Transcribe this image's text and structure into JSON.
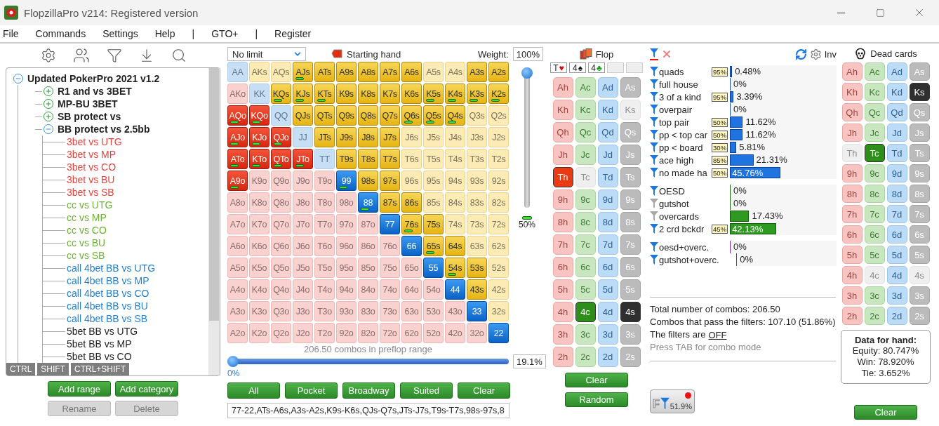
{
  "window": {
    "title": "FlopzillaPro v214: Registered version"
  },
  "menu": [
    {
      "label": "File",
      "kind": "item"
    },
    {
      "label": "Commands",
      "kind": "item"
    },
    {
      "label": "Settings",
      "kind": "item"
    },
    {
      "label": "Help",
      "kind": "item"
    },
    {
      "label": "|",
      "kind": "separator"
    },
    {
      "label": "GTO+",
      "kind": "item"
    },
    {
      "label": "|",
      "kind": "separator"
    },
    {
      "label": "Register",
      "kind": "item"
    }
  ],
  "ranges": {
    "tree": {
      "label": "Updated PokerPro 2021 v1.2",
      "expanded": true,
      "children": [
        {
          "label": "R1 and vs 3BET",
          "expanded": false
        },
        {
          "label": "MP-BU 3BET",
          "expanded": false
        },
        {
          "label": "SB protect vs",
          "expanded": false
        },
        {
          "label": "BB protect vs 2.5bb",
          "expanded": true,
          "children": [
            {
              "label": "3bet vs UTG",
              "color": "#e8413c"
            },
            {
              "label": "3bet vs MP",
              "color": "#e8413c"
            },
            {
              "label": "3bet vs CO",
              "color": "#e8413c"
            },
            {
              "label": "3bet vs BU",
              "color": "#e8413c"
            },
            {
              "label": "3bet vs SB",
              "color": "#e8413c"
            },
            {
              "label": "cc vs UTG",
              "color": "#6cb232"
            },
            {
              "label": "cc vs MP",
              "color": "#6cb232"
            },
            {
              "label": "cc vs CO",
              "color": "#6cb232"
            },
            {
              "label": "cc vs BU",
              "color": "#6cb232"
            },
            {
              "label": "cc vs SB",
              "color": "#6cb232"
            },
            {
              "label": "call 4bet BB vs UTG",
              "color": "#1f7fd0"
            },
            {
              "label": "call 4bet BB vs MP",
              "color": "#1f7fd0"
            },
            {
              "label": "call 4bet BB vs CO",
              "color": "#1f7fd0"
            },
            {
              "label": "call 4bet BB vs BU",
              "color": "#1f7fd0"
            },
            {
              "label": "call 4bet BB vs SB",
              "color": "#1f7fd0"
            },
            {
              "label": "5bet BB vs UTG",
              "color": "#222222"
            },
            {
              "label": "5bet BB vs MP",
              "color": "#222222"
            },
            {
              "label": "5bet BB vs CO",
              "color": "#222222"
            }
          ]
        }
      ]
    },
    "modifier_keys": [
      "CTRL",
      "SHIFT",
      "CTRL+SHIFT"
    ],
    "buttons": [
      {
        "label": "Add range",
        "disabled": false
      },
      {
        "label": "Add category",
        "disabled": false
      },
      {
        "label": "Rename",
        "disabled": true
      },
      {
        "label": "Delete",
        "disabled": true
      }
    ]
  },
  "hand_matrix": {
    "game": "No limit",
    "title": "Starting hand",
    "weight_label": "Weight:",
    "weight": "100%",
    "threshold": {
      "level": 1,
      "reading": "50%"
    },
    "rows": [
      [
        {
          "label": "AA",
          "selected": false,
          "weight_mark": false
        },
        {
          "label": "AKs",
          "selected": false,
          "weight_mark": false
        },
        {
          "label": "AQs",
          "selected": false,
          "weight_mark": false
        },
        {
          "label": "AJs",
          "selected": true,
          "weight_mark": true
        },
        {
          "label": "ATs",
          "selected": true,
          "weight_mark": false
        },
        {
          "label": "A9s",
          "selected": true,
          "weight_mark": false
        },
        {
          "label": "A8s",
          "selected": true,
          "weight_mark": false
        },
        {
          "label": "A7s",
          "selected": true,
          "weight_mark": false
        },
        {
          "label": "A6s",
          "selected": true,
          "weight_mark": false
        },
        {
          "label": "A5s",
          "selected": false,
          "weight_mark": false
        },
        {
          "label": "A4s",
          "selected": false,
          "weight_mark": false
        },
        {
          "label": "A3s",
          "selected": true,
          "weight_mark": false
        },
        {
          "label": "A2s",
          "selected": true,
          "weight_mark": false
        }
      ],
      [
        {
          "label": "AKo",
          "selected": false,
          "weight_mark": false
        },
        {
          "label": "KK",
          "selected": false,
          "weight_mark": false
        },
        {
          "label": "KQs",
          "selected": true,
          "weight_mark": true
        },
        {
          "label": "KJs",
          "selected": true,
          "weight_mark": true
        },
        {
          "label": "KTs",
          "selected": true,
          "weight_mark": true
        },
        {
          "label": "K9s",
          "selected": true,
          "weight_mark": false
        },
        {
          "label": "K8s",
          "selected": true,
          "weight_mark": false
        },
        {
          "label": "K7s",
          "selected": true,
          "weight_mark": false
        },
        {
          "label": "K6s",
          "selected": true,
          "weight_mark": false
        },
        {
          "label": "K5s",
          "selected": true,
          "weight_mark": true
        },
        {
          "label": "K4s",
          "selected": true,
          "weight_mark": true
        },
        {
          "label": "K3s",
          "selected": true,
          "weight_mark": true
        },
        {
          "label": "K2s",
          "selected": true,
          "weight_mark": true
        }
      ],
      [
        {
          "label": "AQo",
          "selected": true,
          "weight_mark": true
        },
        {
          "label": "KQo",
          "selected": true,
          "weight_mark": true
        },
        {
          "label": "QQ",
          "selected": false,
          "weight_mark": false
        },
        {
          "label": "QJs",
          "selected": true,
          "weight_mark": false
        },
        {
          "label": "QTs",
          "selected": true,
          "weight_mark": false
        },
        {
          "label": "Q9s",
          "selected": true,
          "weight_mark": false
        },
        {
          "label": "Q8s",
          "selected": true,
          "weight_mark": false
        },
        {
          "label": "Q7s",
          "selected": true,
          "weight_mark": false
        },
        {
          "label": "Q6s",
          "selected": true,
          "weight_mark": true
        },
        {
          "label": "Q5s",
          "selected": true,
          "weight_mark": true
        },
        {
          "label": "Q4s",
          "selected": true,
          "weight_mark": true
        },
        {
          "label": "Q3s",
          "selected": false,
          "weight_mark": false
        },
        {
          "label": "Q2s",
          "selected": false,
          "weight_mark": false
        }
      ],
      [
        {
          "label": "AJo",
          "selected": true,
          "weight_mark": true
        },
        {
          "label": "KJo",
          "selected": true,
          "weight_mark": true
        },
        {
          "label": "QJo",
          "selected": true,
          "weight_mark": true
        },
        {
          "label": "JJ",
          "selected": false,
          "weight_mark": false
        },
        {
          "label": "JTs",
          "selected": true,
          "weight_mark": false
        },
        {
          "label": "J9s",
          "selected": true,
          "weight_mark": false
        },
        {
          "label": "J8s",
          "selected": true,
          "weight_mark": false
        },
        {
          "label": "J7s",
          "selected": true,
          "weight_mark": false
        },
        {
          "label": "J6s",
          "selected": false,
          "weight_mark": false
        },
        {
          "label": "J5s",
          "selected": false,
          "weight_mark": false
        },
        {
          "label": "J4s",
          "selected": false,
          "weight_mark": false
        },
        {
          "label": "J3s",
          "selected": false,
          "weight_mark": false
        },
        {
          "label": "J2s",
          "selected": false,
          "weight_mark": false
        }
      ],
      [
        {
          "label": "ATo",
          "selected": true,
          "weight_mark": true
        },
        {
          "label": "KTo",
          "selected": true,
          "weight_mark": true
        },
        {
          "label": "QTo",
          "selected": true,
          "weight_mark": true
        },
        {
          "label": "JTo",
          "selected": true,
          "weight_mark": true
        },
        {
          "label": "TT",
          "selected": false,
          "weight_mark": false
        },
        {
          "label": "T9s",
          "selected": true,
          "weight_mark": false
        },
        {
          "label": "T8s",
          "selected": true,
          "weight_mark": false
        },
        {
          "label": "T7s",
          "selected": true,
          "weight_mark": false
        },
        {
          "label": "T6s",
          "selected": false,
          "weight_mark": false
        },
        {
          "label": "T5s",
          "selected": false,
          "weight_mark": false
        },
        {
          "label": "T4s",
          "selected": false,
          "weight_mark": false
        },
        {
          "label": "T3s",
          "selected": false,
          "weight_mark": false
        },
        {
          "label": "T2s",
          "selected": false,
          "weight_mark": false
        }
      ],
      [
        {
          "label": "A9o",
          "selected": true,
          "weight_mark": true
        },
        {
          "label": "K9o",
          "selected": false,
          "weight_mark": false
        },
        {
          "label": "Q9o",
          "selected": false,
          "weight_mark": false
        },
        {
          "label": "J9o",
          "selected": false,
          "weight_mark": false
        },
        {
          "label": "T9o",
          "selected": false,
          "weight_mark": false
        },
        {
          "label": "99",
          "selected": true,
          "weight_mark": true
        },
        {
          "label": "98s",
          "selected": true,
          "weight_mark": false
        },
        {
          "label": "97s",
          "selected": true,
          "weight_mark": false
        },
        {
          "label": "96s",
          "selected": false,
          "weight_mark": false
        },
        {
          "label": "95s",
          "selected": false,
          "weight_mark": false
        },
        {
          "label": "94s",
          "selected": false,
          "weight_mark": false
        },
        {
          "label": "93s",
          "selected": false,
          "weight_mark": false
        },
        {
          "label": "92s",
          "selected": false,
          "weight_mark": false
        }
      ],
      [
        {
          "label": "A8o",
          "selected": false,
          "weight_mark": false
        },
        {
          "label": "K8o",
          "selected": false,
          "weight_mark": false
        },
        {
          "label": "Q8o",
          "selected": false,
          "weight_mark": false
        },
        {
          "label": "J8o",
          "selected": false,
          "weight_mark": false
        },
        {
          "label": "T8o",
          "selected": false,
          "weight_mark": false
        },
        {
          "label": "98o",
          "selected": false,
          "weight_mark": false
        },
        {
          "label": "88",
          "selected": true,
          "weight_mark": true
        },
        {
          "label": "87s",
          "selected": true,
          "weight_mark": false
        },
        {
          "label": "86s",
          "selected": true,
          "weight_mark": false
        },
        {
          "label": "85s",
          "selected": false,
          "weight_mark": false
        },
        {
          "label": "84s",
          "selected": false,
          "weight_mark": false
        },
        {
          "label": "83s",
          "selected": false,
          "weight_mark": false
        },
        {
          "label": "82s",
          "selected": false,
          "weight_mark": false
        }
      ],
      [
        {
          "label": "A7o",
          "selected": false,
          "weight_mark": false
        },
        {
          "label": "K7o",
          "selected": false,
          "weight_mark": false
        },
        {
          "label": "Q7o",
          "selected": false,
          "weight_mark": false
        },
        {
          "label": "J7o",
          "selected": false,
          "weight_mark": false
        },
        {
          "label": "T7o",
          "selected": false,
          "weight_mark": false
        },
        {
          "label": "97o",
          "selected": false,
          "weight_mark": false
        },
        {
          "label": "87o",
          "selected": false,
          "weight_mark": false
        },
        {
          "label": "77",
          "selected": true,
          "weight_mark": false
        },
        {
          "label": "76s",
          "selected": true,
          "weight_mark": true
        },
        {
          "label": "75s",
          "selected": true,
          "weight_mark": false
        },
        {
          "label": "74s",
          "selected": false,
          "weight_mark": false
        },
        {
          "label": "73s",
          "selected": false,
          "weight_mark": false
        },
        {
          "label": "72s",
          "selected": false,
          "weight_mark": false
        }
      ],
      [
        {
          "label": "A6o",
          "selected": false,
          "weight_mark": false
        },
        {
          "label": "K6o",
          "selected": false,
          "weight_mark": false
        },
        {
          "label": "Q6o",
          "selected": false,
          "weight_mark": false
        },
        {
          "label": "J6o",
          "selected": false,
          "weight_mark": false
        },
        {
          "label": "T6o",
          "selected": false,
          "weight_mark": false
        },
        {
          "label": "96o",
          "selected": false,
          "weight_mark": false
        },
        {
          "label": "86o",
          "selected": false,
          "weight_mark": false
        },
        {
          "label": "76o",
          "selected": false,
          "weight_mark": false
        },
        {
          "label": "66",
          "selected": true,
          "weight_mark": false
        },
        {
          "label": "65s",
          "selected": true,
          "weight_mark": true
        },
        {
          "label": "64s",
          "selected": true,
          "weight_mark": false
        },
        {
          "label": "63s",
          "selected": false,
          "weight_mark": false
        },
        {
          "label": "62s",
          "selected": false,
          "weight_mark": false
        }
      ],
      [
        {
          "label": "A5o",
          "selected": false,
          "weight_mark": false
        },
        {
          "label": "K5o",
          "selected": false,
          "weight_mark": false
        },
        {
          "label": "Q5o",
          "selected": false,
          "weight_mark": false
        },
        {
          "label": "J5o",
          "selected": false,
          "weight_mark": false
        },
        {
          "label": "T5o",
          "selected": false,
          "weight_mark": false
        },
        {
          "label": "95o",
          "selected": false,
          "weight_mark": false
        },
        {
          "label": "85o",
          "selected": false,
          "weight_mark": false
        },
        {
          "label": "75o",
          "selected": false,
          "weight_mark": false
        },
        {
          "label": "65o",
          "selected": false,
          "weight_mark": false
        },
        {
          "label": "55",
          "selected": true,
          "weight_mark": false
        },
        {
          "label": "54s",
          "selected": true,
          "weight_mark": true
        },
        {
          "label": "53s",
          "selected": true,
          "weight_mark": false
        },
        {
          "label": "52s",
          "selected": false,
          "weight_mark": false
        }
      ],
      [
        {
          "label": "A4o",
          "selected": false,
          "weight_mark": false
        },
        {
          "label": "K4o",
          "selected": false,
          "weight_mark": false
        },
        {
          "label": "Q4o",
          "selected": false,
          "weight_mark": false
        },
        {
          "label": "J4o",
          "selected": false,
          "weight_mark": false
        },
        {
          "label": "T4o",
          "selected": false,
          "weight_mark": false
        },
        {
          "label": "94o",
          "selected": false,
          "weight_mark": false
        },
        {
          "label": "84o",
          "selected": false,
          "weight_mark": false
        },
        {
          "label": "74o",
          "selected": false,
          "weight_mark": false
        },
        {
          "label": "64o",
          "selected": false,
          "weight_mark": false
        },
        {
          "label": "54o",
          "selected": false,
          "weight_mark": false
        },
        {
          "label": "44",
          "selected": true,
          "weight_mark": false
        },
        {
          "label": "43s",
          "selected": true,
          "weight_mark": false
        },
        {
          "label": "42s",
          "selected": false,
          "weight_mark": false
        }
      ],
      [
        {
          "label": "A3o",
          "selected": false,
          "weight_mark": false
        },
        {
          "label": "K3o",
          "selected": false,
          "weight_mark": false
        },
        {
          "label": "Q3o",
          "selected": false,
          "weight_mark": false
        },
        {
          "label": "J3o",
          "selected": false,
          "weight_mark": false
        },
        {
          "label": "T3o",
          "selected": false,
          "weight_mark": false
        },
        {
          "label": "93o",
          "selected": false,
          "weight_mark": false
        },
        {
          "label": "83o",
          "selected": false,
          "weight_mark": false
        },
        {
          "label": "73o",
          "selected": false,
          "weight_mark": false
        },
        {
          "label": "63o",
          "selected": false,
          "weight_mark": false
        },
        {
          "label": "53o",
          "selected": false,
          "weight_mark": false
        },
        {
          "label": "43o",
          "selected": false,
          "weight_mark": false
        },
        {
          "label": "33",
          "selected": true,
          "weight_mark": false
        },
        {
          "label": "32s",
          "selected": false,
          "weight_mark": false
        }
      ],
      [
        {
          "label": "A2o",
          "selected": false,
          "weight_mark": false
        },
        {
          "label": "K2o",
          "selected": false,
          "weight_mark": false
        },
        {
          "label": "Q2o",
          "selected": false,
          "weight_mark": false
        },
        {
          "label": "J2o",
          "selected": false,
          "weight_mark": false
        },
        {
          "label": "T2o",
          "selected": false,
          "weight_mark": false
        },
        {
          "label": "92o",
          "selected": false,
          "weight_mark": false
        },
        {
          "label": "82o",
          "selected": false,
          "weight_mark": false
        },
        {
          "label": "72o",
          "selected": false,
          "weight_mark": false
        },
        {
          "label": "62o",
          "selected": false,
          "weight_mark": false
        },
        {
          "label": "52o",
          "selected": false,
          "weight_mark": false
        },
        {
          "label": "42o",
          "selected": false,
          "weight_mark": false
        },
        {
          "label": "32o",
          "selected": false,
          "weight_mark": false
        },
        {
          "label": "22",
          "selected": true,
          "weight_mark": false
        }
      ]
    ],
    "combos_caption": "206.50 combos in preflop range",
    "range_slider": {
      "level": 0,
      "reading": "0%"
    },
    "range_percent": "19.1%",
    "buttons": [
      "All",
      "Pocket",
      "Broadway",
      "Suited",
      "Clear"
    ],
    "range_text": "77-22,ATs-A6s,A3s-A2s,K9s-K6s,QJs-Q7s,JTs-J7s,T9s-T7s,98s-97s,8"
  },
  "flop": {
    "title": "Flop",
    "board": [
      {
        "rank": "T",
        "suit": "♥",
        "color": "#e00000"
      },
      {
        "rank": "4",
        "suit": "♠",
        "color": "#111111"
      },
      {
        "rank": "4",
        "suit": "♣",
        "color": "#1a9a1a"
      }
    ],
    "cards": [
      {
        "label": "Ah",
        "selected": false,
        "disabled": false
      },
      {
        "label": "Ac",
        "selected": false,
        "disabled": false
      },
      {
        "label": "Ad",
        "selected": false,
        "disabled": false
      },
      {
        "label": "As",
        "selected": false,
        "disabled": false
      },
      {
        "label": "Kh",
        "selected": false,
        "disabled": false
      },
      {
        "label": "Kc",
        "selected": false,
        "disabled": false
      },
      {
        "label": "Kd",
        "selected": false,
        "disabled": false
      },
      {
        "label": "Ks",
        "selected": false,
        "disabled": true
      },
      {
        "label": "Qh",
        "selected": false,
        "disabled": false
      },
      {
        "label": "Qc",
        "selected": false,
        "disabled": false
      },
      {
        "label": "Qd",
        "selected": false,
        "disabled": false
      },
      {
        "label": "Qs",
        "selected": false,
        "disabled": false
      },
      {
        "label": "Jh",
        "selected": false,
        "disabled": false
      },
      {
        "label": "Jc",
        "selected": false,
        "disabled": false
      },
      {
        "label": "Jd",
        "selected": false,
        "disabled": false
      },
      {
        "label": "Js",
        "selected": false,
        "disabled": false
      },
      {
        "label": "Th",
        "selected": true,
        "disabled": false
      },
      {
        "label": "Tc",
        "selected": false,
        "disabled": true
      },
      {
        "label": "Td",
        "selected": false,
        "disabled": false
      },
      {
        "label": "Ts",
        "selected": false,
        "disabled": false
      },
      {
        "label": "9h",
        "selected": false,
        "disabled": false
      },
      {
        "label": "9c",
        "selected": false,
        "disabled": false
      },
      {
        "label": "9d",
        "selected": false,
        "disabled": false
      },
      {
        "label": "9s",
        "selected": false,
        "disabled": false
      },
      {
        "label": "8h",
        "selected": false,
        "disabled": false
      },
      {
        "label": "8c",
        "selected": false,
        "disabled": false
      },
      {
        "label": "8d",
        "selected": false,
        "disabled": false
      },
      {
        "label": "8s",
        "selected": false,
        "disabled": false
      },
      {
        "label": "7h",
        "selected": false,
        "disabled": false
      },
      {
        "label": "7c",
        "selected": false,
        "disabled": false
      },
      {
        "label": "7d",
        "selected": false,
        "disabled": false
      },
      {
        "label": "7s",
        "selected": false,
        "disabled": false
      },
      {
        "label": "6h",
        "selected": false,
        "disabled": false
      },
      {
        "label": "6c",
        "selected": false,
        "disabled": false
      },
      {
        "label": "6d",
        "selected": false,
        "disabled": false
      },
      {
        "label": "6s",
        "selected": false,
        "disabled": false
      },
      {
        "label": "5h",
        "selected": false,
        "disabled": false
      },
      {
        "label": "5c",
        "selected": false,
        "disabled": false
      },
      {
        "label": "5d",
        "selected": false,
        "disabled": false
      },
      {
        "label": "5s",
        "selected": false,
        "disabled": false
      },
      {
        "label": "4h",
        "selected": false,
        "disabled": false
      },
      {
        "label": "4c",
        "selected": true,
        "disabled": false
      },
      {
        "label": "4d",
        "selected": false,
        "disabled": false
      },
      {
        "label": "4s",
        "selected": true,
        "disabled": false
      },
      {
        "label": "3h",
        "selected": false,
        "disabled": false
      },
      {
        "label": "3c",
        "selected": false,
        "disabled": false
      },
      {
        "label": "3d",
        "selected": false,
        "disabled": false
      },
      {
        "label": "3s",
        "selected": false,
        "disabled": false
      },
      {
        "label": "2h",
        "selected": false,
        "disabled": false
      },
      {
        "label": "2c",
        "selected": false,
        "disabled": false
      },
      {
        "label": "2d",
        "selected": false,
        "disabled": false
      },
      {
        "label": "2s",
        "selected": false,
        "disabled": false
      }
    ],
    "buttons": [
      "Clear",
      "Random"
    ]
  },
  "stats": {
    "inv_label": "Inv",
    "groups": [
      {
        "kind": "made",
        "rows": [
          {
            "label": "quads",
            "filter_on": true,
            "weight": "95%",
            "value": "0.48%",
            "level": 0.0048
          },
          {
            "label": "full house",
            "filter_on": true,
            "value": "0%",
            "level": 0
          },
          {
            "label": "3 of a kind",
            "filter_on": true,
            "weight": "95%",
            "value": "3.39%",
            "level": 0.0339
          },
          {
            "label": "overpair",
            "filter_on": true,
            "value": "0%",
            "level": 0
          },
          {
            "label": "top pair",
            "filter_on": true,
            "weight": "50%",
            "value": "11.62%",
            "level": 0.1162
          },
          {
            "label": "pp < top car",
            "filter_on": true,
            "weight": "50%",
            "value": "11.62%",
            "level": 0.1162
          },
          {
            "label": "pp < board",
            "filter_on": true,
            "weight": "30%",
            "value": "5.81%",
            "level": 0.0581
          },
          {
            "label": "ace high",
            "filter_on": true,
            "weight": "85%",
            "value": "21.31%",
            "level": 0.2131
          },
          {
            "label": "no made ha",
            "filter_on": true,
            "weight": "50%",
            "value": "45.76%",
            "level": 0.4576
          }
        ]
      },
      {
        "kind": "draw",
        "rows": [
          {
            "label": "OESD",
            "filter_on": true,
            "value": "0%",
            "level": 0
          },
          {
            "label": "gutshot",
            "filter_on": false,
            "value": "0%",
            "level": 0
          },
          {
            "label": "overcards",
            "filter_on": false,
            "value": "17.43%",
            "level": 0.1743
          },
          {
            "label": "2 crd bckdr",
            "filter_on": true,
            "weight": "45%",
            "value": "42.13%",
            "level": 0.4213
          }
        ]
      },
      {
        "kind": "combo",
        "rows": [
          {
            "label": "oesd+overc.",
            "filter_on": true,
            "value": "0%",
            "level": 0
          },
          {
            "label": "gutshot+overc.",
            "filter_on": true,
            "value": "0%",
            "level": 0
          }
        ]
      }
    ],
    "summary": [
      "Total number of combos: 206.50",
      "Combos that pass the filters: 107.10 (51.86%)"
    ],
    "filters_state": {
      "text": "The filters are",
      "link": "OFF"
    },
    "hint": "Press TAB for combo mode",
    "filter_button": {
      "label": "F",
      "reading": "51.9%"
    }
  },
  "dead_cards": {
    "title": "Dead cards",
    "cards": [
      {
        "label": "Ah",
        "selected": false,
        "disabled": false
      },
      {
        "label": "Ac",
        "selected": false,
        "disabled": false
      },
      {
        "label": "Ad",
        "selected": false,
        "disabled": false
      },
      {
        "label": "As",
        "selected": false,
        "disabled": false
      },
      {
        "label": "Kh",
        "selected": false,
        "disabled": false
      },
      {
        "label": "Kc",
        "selected": false,
        "disabled": false
      },
      {
        "label": "Kd",
        "selected": false,
        "disabled": false
      },
      {
        "label": "Ks",
        "selected": true,
        "disabled": false
      },
      {
        "label": "Qh",
        "selected": false,
        "disabled": false
      },
      {
        "label": "Qc",
        "selected": false,
        "disabled": false
      },
      {
        "label": "Qd",
        "selected": false,
        "disabled": false
      },
      {
        "label": "Qs",
        "selected": false,
        "disabled": false
      },
      {
        "label": "Jh",
        "selected": false,
        "disabled": false
      },
      {
        "label": "Jc",
        "selected": false,
        "disabled": false
      },
      {
        "label": "Jd",
        "selected": false,
        "disabled": false
      },
      {
        "label": "Js",
        "selected": false,
        "disabled": false
      },
      {
        "label": "Th",
        "selected": false,
        "disabled": true
      },
      {
        "label": "Tc",
        "selected": true,
        "disabled": false
      },
      {
        "label": "Td",
        "selected": false,
        "disabled": false
      },
      {
        "label": "Ts",
        "selected": false,
        "disabled": false
      },
      {
        "label": "9h",
        "selected": false,
        "disabled": false
      },
      {
        "label": "9c",
        "selected": false,
        "disabled": false
      },
      {
        "label": "9d",
        "selected": false,
        "disabled": false
      },
      {
        "label": "9s",
        "selected": false,
        "disabled": false
      },
      {
        "label": "8h",
        "selected": false,
        "disabled": false
      },
      {
        "label": "8c",
        "selected": false,
        "disabled": false
      },
      {
        "label": "8d",
        "selected": false,
        "disabled": false
      },
      {
        "label": "8s",
        "selected": false,
        "disabled": false
      },
      {
        "label": "7h",
        "selected": false,
        "disabled": false
      },
      {
        "label": "7c",
        "selected": false,
        "disabled": false
      },
      {
        "label": "7d",
        "selected": false,
        "disabled": false
      },
      {
        "label": "7s",
        "selected": false,
        "disabled": false
      },
      {
        "label": "6h",
        "selected": false,
        "disabled": false
      },
      {
        "label": "6c",
        "selected": false,
        "disabled": false
      },
      {
        "label": "6d",
        "selected": false,
        "disabled": false
      },
      {
        "label": "6s",
        "selected": false,
        "disabled": false
      },
      {
        "label": "5h",
        "selected": false,
        "disabled": false
      },
      {
        "label": "5c",
        "selected": false,
        "disabled": false
      },
      {
        "label": "5d",
        "selected": false,
        "disabled": false
      },
      {
        "label": "5s",
        "selected": false,
        "disabled": false
      },
      {
        "label": "4h",
        "selected": false,
        "disabled": false
      },
      {
        "label": "4c",
        "selected": false,
        "disabled": true
      },
      {
        "label": "4d",
        "selected": false,
        "disabled": false
      },
      {
        "label": "4s",
        "selected": false,
        "disabled": true
      },
      {
        "label": "3h",
        "selected": false,
        "disabled": false
      },
      {
        "label": "3c",
        "selected": false,
        "disabled": false
      },
      {
        "label": "3d",
        "selected": false,
        "disabled": false
      },
      {
        "label": "3s",
        "selected": false,
        "disabled": false
      },
      {
        "label": "2h",
        "selected": false,
        "disabled": false
      },
      {
        "label": "2c",
        "selected": false,
        "disabled": false
      },
      {
        "label": "2d",
        "selected": false,
        "disabled": false
      },
      {
        "label": "2s",
        "selected": false,
        "disabled": false
      }
    ],
    "hand_data": {
      "title": "Data for hand:",
      "lines": [
        "Equity: 80.747%",
        "Win: 78.920%",
        "Tie: 3.652%"
      ]
    },
    "button": "Clear"
  }
}
